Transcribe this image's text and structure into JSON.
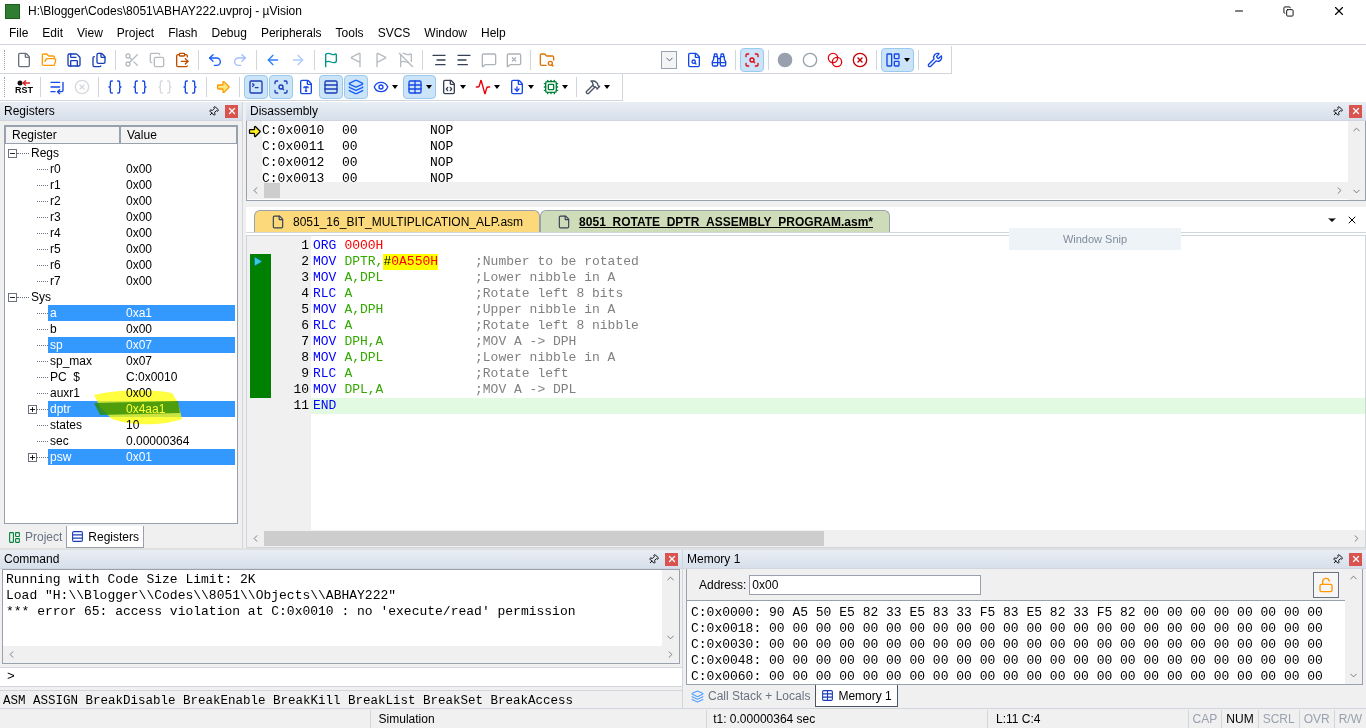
{
  "window": {
    "title": "H:\\Blogger\\Codes\\8051\\ABHAY222.uvproj - µVision"
  },
  "menu": [
    "File",
    "Edit",
    "View",
    "Project",
    "Flash",
    "Debug",
    "Peripherals",
    "Tools",
    "SVCS",
    "Window",
    "Help"
  ],
  "toolbar_1": [
    {
      "kind": "button",
      "disabled": false,
      "active": false
    },
    {
      "kind": "button",
      "disabled": false,
      "active": false
    },
    {
      "kind": "button",
      "disabled": false,
      "active": false
    },
    {
      "kind": "button",
      "disabled": false,
      "active": false
    },
    {
      "kind": "separator"
    },
    {
      "kind": "button",
      "disabled": true,
      "active": false
    },
    {
      "kind": "button",
      "disabled": true,
      "active": false
    },
    {
      "kind": "button",
      "disabled": false,
      "active": false
    },
    {
      "kind": "separator"
    },
    {
      "kind": "button",
      "disabled": false,
      "active": false
    },
    {
      "kind": "button",
      "disabled": true,
      "active": false
    },
    {
      "kind": "separator"
    },
    {
      "kind": "button",
      "disabled": false,
      "active": false
    },
    {
      "kind": "button",
      "disabled": true,
      "active": false
    },
    {
      "kind": "separator"
    },
    {
      "kind": "button",
      "disabled": false,
      "active": false
    },
    {
      "kind": "button",
      "disabled": true,
      "active": false
    },
    {
      "kind": "button",
      "disabled": true,
      "active": false
    },
    {
      "kind": "button",
      "disabled": true,
      "active": false
    },
    {
      "kind": "separator"
    },
    {
      "kind": "button",
      "disabled": false,
      "active": false
    },
    {
      "kind": "button",
      "disabled": false,
      "active": false
    },
    {
      "kind": "button",
      "disabled": true,
      "active": false
    },
    {
      "kind": "button",
      "disabled": true,
      "active": false
    },
    {
      "kind": "separator"
    },
    {
      "kind": "button",
      "disabled": false,
      "active": false
    },
    {
      "kind": "combo"
    },
    {
      "kind": "button",
      "disabled": false,
      "active": false
    },
    {
      "kind": "button",
      "disabled": false,
      "active": false
    },
    {
      "kind": "separator"
    },
    {
      "kind": "button",
      "disabled": false,
      "active": true
    },
    {
      "kind": "separator"
    },
    {
      "kind": "button",
      "disabled": false,
      "active": false
    },
    {
      "kind": "button",
      "disabled": false,
      "active": false
    },
    {
      "kind": "button",
      "disabled": false,
      "active": false
    },
    {
      "kind": "button",
      "disabled": false,
      "active": false
    },
    {
      "kind": "separator"
    },
    {
      "kind": "dropdown",
      "disabled": false,
      "active": true
    },
    {
      "kind": "separator"
    },
    {
      "kind": "button",
      "disabled": false,
      "active": false
    }
  ],
  "toolbar_2": [
    {
      "kind": "button",
      "disabled": false,
      "active": false,
      "label": "RST"
    },
    {
      "kind": "separator"
    },
    {
      "kind": "button",
      "disabled": false,
      "active": false
    },
    {
      "kind": "button",
      "disabled": true,
      "active": false
    },
    {
      "kind": "separator"
    },
    {
      "kind": "button",
      "disabled": false,
      "active": false
    },
    {
      "kind": "button",
      "disabled": false,
      "active": false
    },
    {
      "kind": "button",
      "disabled": true,
      "active": false
    },
    {
      "kind": "button",
      "disabled": false,
      "active": false
    },
    {
      "kind": "separator"
    },
    {
      "kind": "button",
      "disabled": false,
      "active": false
    },
    {
      "kind": "separator"
    },
    {
      "kind": "button",
      "disabled": false,
      "active": true
    },
    {
      "kind": "button",
      "disabled": false,
      "active": true
    },
    {
      "kind": "button",
      "disabled": false,
      "active": false
    },
    {
      "kind": "button",
      "disabled": false,
      "active": true
    },
    {
      "kind": "button",
      "disabled": false,
      "active": true
    },
    {
      "kind": "dropdown",
      "disabled": false,
      "active": false
    },
    {
      "kind": "dropdown",
      "disabled": false,
      "active": true
    },
    {
      "kind": "dropdown",
      "disabled": false,
      "active": false
    },
    {
      "kind": "dropdown",
      "disabled": false,
      "active": false
    },
    {
      "kind": "dropdown",
      "disabled": false,
      "active": false
    },
    {
      "kind": "dropdown",
      "disabled": false,
      "active": false
    },
    {
      "kind": "separator"
    },
    {
      "kind": "dropdown",
      "disabled": false,
      "active": false
    }
  ],
  "registers_panel": {
    "title": "Registers",
    "columns": [
      "Register",
      "Value"
    ],
    "tree": [
      {
        "name": "Regs",
        "expanded": true,
        "selected": false,
        "children": [
          {
            "name": "r0",
            "value": "0x00",
            "selected": false
          },
          {
            "name": "r1",
            "value": "0x00",
            "selected": false
          },
          {
            "name": "r2",
            "value": "0x00",
            "selected": false
          },
          {
            "name": "r3",
            "value": "0x00",
            "selected": false
          },
          {
            "name": "r4",
            "value": "0x00",
            "selected": false
          },
          {
            "name": "r5",
            "value": "0x00",
            "selected": false
          },
          {
            "name": "r6",
            "value": "0x00",
            "selected": false
          },
          {
            "name": "r7",
            "value": "0x00",
            "selected": false
          }
        ]
      },
      {
        "name": "Sys",
        "expanded": true,
        "selected": false,
        "children": [
          {
            "name": "a",
            "value": "0xa1",
            "selected": true
          },
          {
            "name": "b",
            "value": "0x00",
            "selected": false
          },
          {
            "name": "sp",
            "value": "0x07",
            "selected": true
          },
          {
            "name": "sp_max",
            "value": "0x07",
            "selected": false
          },
          {
            "name": "PC  $",
            "value": "C:0x0010",
            "selected": false
          },
          {
            "name": "auxr1",
            "value": "0x00",
            "selected": false
          },
          {
            "name": "dptr",
            "value": "0x4aa1",
            "selected": true,
            "expanded": false,
            "highlighted": true
          },
          {
            "name": "states",
            "value": "10",
            "selected": false
          },
          {
            "name": "sec",
            "value": "0.00000364",
            "selected": false
          },
          {
            "name": "psw",
            "value": "0x01",
            "selected": true,
            "expanded": false
          }
        ]
      }
    ],
    "tabs": [
      {
        "label": "Project",
        "selected": false
      },
      {
        "label": "Registers",
        "selected": true
      }
    ]
  },
  "disassembly": {
    "title": "Disassembly",
    "rows": [
      {
        "address": "C:0x0010",
        "opcode": "00",
        "mnemonic": "NOP",
        "current": true
      },
      {
        "address": "C:0x0011",
        "opcode": "00",
        "mnemonic": "NOP",
        "current": false
      },
      {
        "address": "C:0x0012",
        "opcode": "00",
        "mnemonic": "NOP",
        "current": false
      },
      {
        "address": "C:0x0013",
        "opcode": "00",
        "mnemonic": "NOP",
        "current": false
      }
    ]
  },
  "editor": {
    "tabs": [
      {
        "label": "8051_16_BIT_MULTIPLICATION_ALP.asm",
        "selected": false
      },
      {
        "label": "8051_ROTATE_DPTR_ASSEMBLY_PROGRAM.asm*",
        "selected": true
      }
    ],
    "lines": [
      {
        "number": "1",
        "tokens": [
          {
            "kind": "keyword",
            "text": "ORG"
          },
          {
            "kind": "number",
            "text": "0000H"
          }
        ],
        "executed": false,
        "current": false,
        "cursor_line": false
      },
      {
        "number": "2",
        "tokens": [
          {
            "kind": "keyword",
            "text": "MOV"
          },
          {
            "kind": "operand",
            "text": "DPTR,"
          },
          {
            "kind": "plain",
            "text": "#",
            "highlight": true
          },
          {
            "kind": "number",
            "text": "0A550H",
            "highlight": true
          }
        ],
        "comment": ";Number to be rotated",
        "executed": true,
        "current": true,
        "cursor_line": false
      },
      {
        "number": "3",
        "tokens": [
          {
            "kind": "keyword",
            "text": "MOV"
          },
          {
            "kind": "operand",
            "text": "A,DPL"
          }
        ],
        "comment": ";Lower nibble in A",
        "executed": true,
        "current": false,
        "cursor_line": false
      },
      {
        "number": "4",
        "tokens": [
          {
            "kind": "keyword",
            "text": "RLC"
          },
          {
            "kind": "operand",
            "text": "A"
          }
        ],
        "comment": ";Rotate left 8 bits",
        "executed": true,
        "current": false,
        "cursor_line": false
      },
      {
        "number": "5",
        "tokens": [
          {
            "kind": "keyword",
            "text": "MOV"
          },
          {
            "kind": "operand",
            "text": "A,DPH"
          }
        ],
        "comment": ";Upper nibble in A",
        "executed": true,
        "current": false,
        "cursor_line": false
      },
      {
        "number": "6",
        "tokens": [
          {
            "kind": "keyword",
            "text": "RLC"
          },
          {
            "kind": "operand",
            "text": "A"
          }
        ],
        "comment": ";Rotate left 8 nibble",
        "executed": true,
        "current": false,
        "cursor_line": false
      },
      {
        "number": "7",
        "tokens": [
          {
            "kind": "keyword",
            "text": "MOV"
          },
          {
            "kind": "operand",
            "text": "DPH,A"
          }
        ],
        "comment": ";MOV A -> DPH",
        "executed": true,
        "current": false,
        "cursor_line": false
      },
      {
        "number": "8",
        "tokens": [
          {
            "kind": "keyword",
            "text": "MOV"
          },
          {
            "kind": "operand",
            "text": "A,DPL"
          }
        ],
        "comment": ";Lower nibble in A",
        "executed": true,
        "current": false,
        "cursor_line": false
      },
      {
        "number": "9",
        "tokens": [
          {
            "kind": "keyword",
            "text": "RLC"
          },
          {
            "kind": "operand",
            "text": "A"
          }
        ],
        "comment": ";Rotate left",
        "executed": true,
        "current": false,
        "cursor_line": false
      },
      {
        "number": "10",
        "tokens": [
          {
            "kind": "keyword",
            "text": "MOV"
          },
          {
            "kind": "operand",
            "text": "DPL,A"
          }
        ],
        "comment": ";MOV A -> DPL",
        "executed": true,
        "current": false,
        "cursor_line": false
      },
      {
        "number": "11",
        "tokens": [
          {
            "kind": "keyword",
            "text": "END"
          }
        ],
        "executed": false,
        "current": false,
        "cursor_line": true
      }
    ]
  },
  "snip_hint": "Window Snip",
  "command": {
    "title": "Command",
    "output": [
      "Running with Code Size Limit: 2K",
      "Load \"H:\\\\Blogger\\\\Codes\\\\8051\\\\Objects\\\\ABHAY222\"",
      "*** error 65: access violation at C:0x0010 : no 'execute/read' permission"
    ],
    "prompt": ">",
    "hint": "ASM ASSIGN BreakDisable BreakEnable BreakKill BreakList BreakSet BreakAccess"
  },
  "memory": {
    "title": "Memory 1",
    "address_label": "Address:",
    "address": "0x00",
    "rows": [
      "C:0x0000: 90 A5 50 E5 82 33 E5 83 33 F5 83 E5 82 33 F5 82 00 00 00 00 00 00 00 00",
      "C:0x0018: 00 00 00 00 00 00 00 00 00 00 00 00 00 00 00 00 00 00 00 00 00 00 00 00",
      "C:0x0030: 00 00 00 00 00 00 00 00 00 00 00 00 00 00 00 00 00 00 00 00 00 00 00 00",
      "C:0x0048: 00 00 00 00 00 00 00 00 00 00 00 00 00 00 00 00 00 00 00 00 00 00 00 00",
      "C:0x0060: 00 00 00 00 00 00 00 00 00 00 00 00 00 00 00 00 00 00 00 00 00 00 00 00"
    ],
    "tabs": [
      {
        "label": "Call Stack + Locals",
        "selected": false
      },
      {
        "label": "Memory 1",
        "selected": true
      }
    ]
  },
  "status_bar": {
    "mode": "Simulation",
    "time": "t1: 0.00000364 sec",
    "position": "L:11 C:4",
    "indicators": [
      {
        "label": "CAP",
        "on": false
      },
      {
        "label": "NUM",
        "on": true
      },
      {
        "label": "SCRL",
        "on": false
      },
      {
        "label": "OVR",
        "on": false
      },
      {
        "label": "R/W",
        "on": false
      }
    ]
  }
}
